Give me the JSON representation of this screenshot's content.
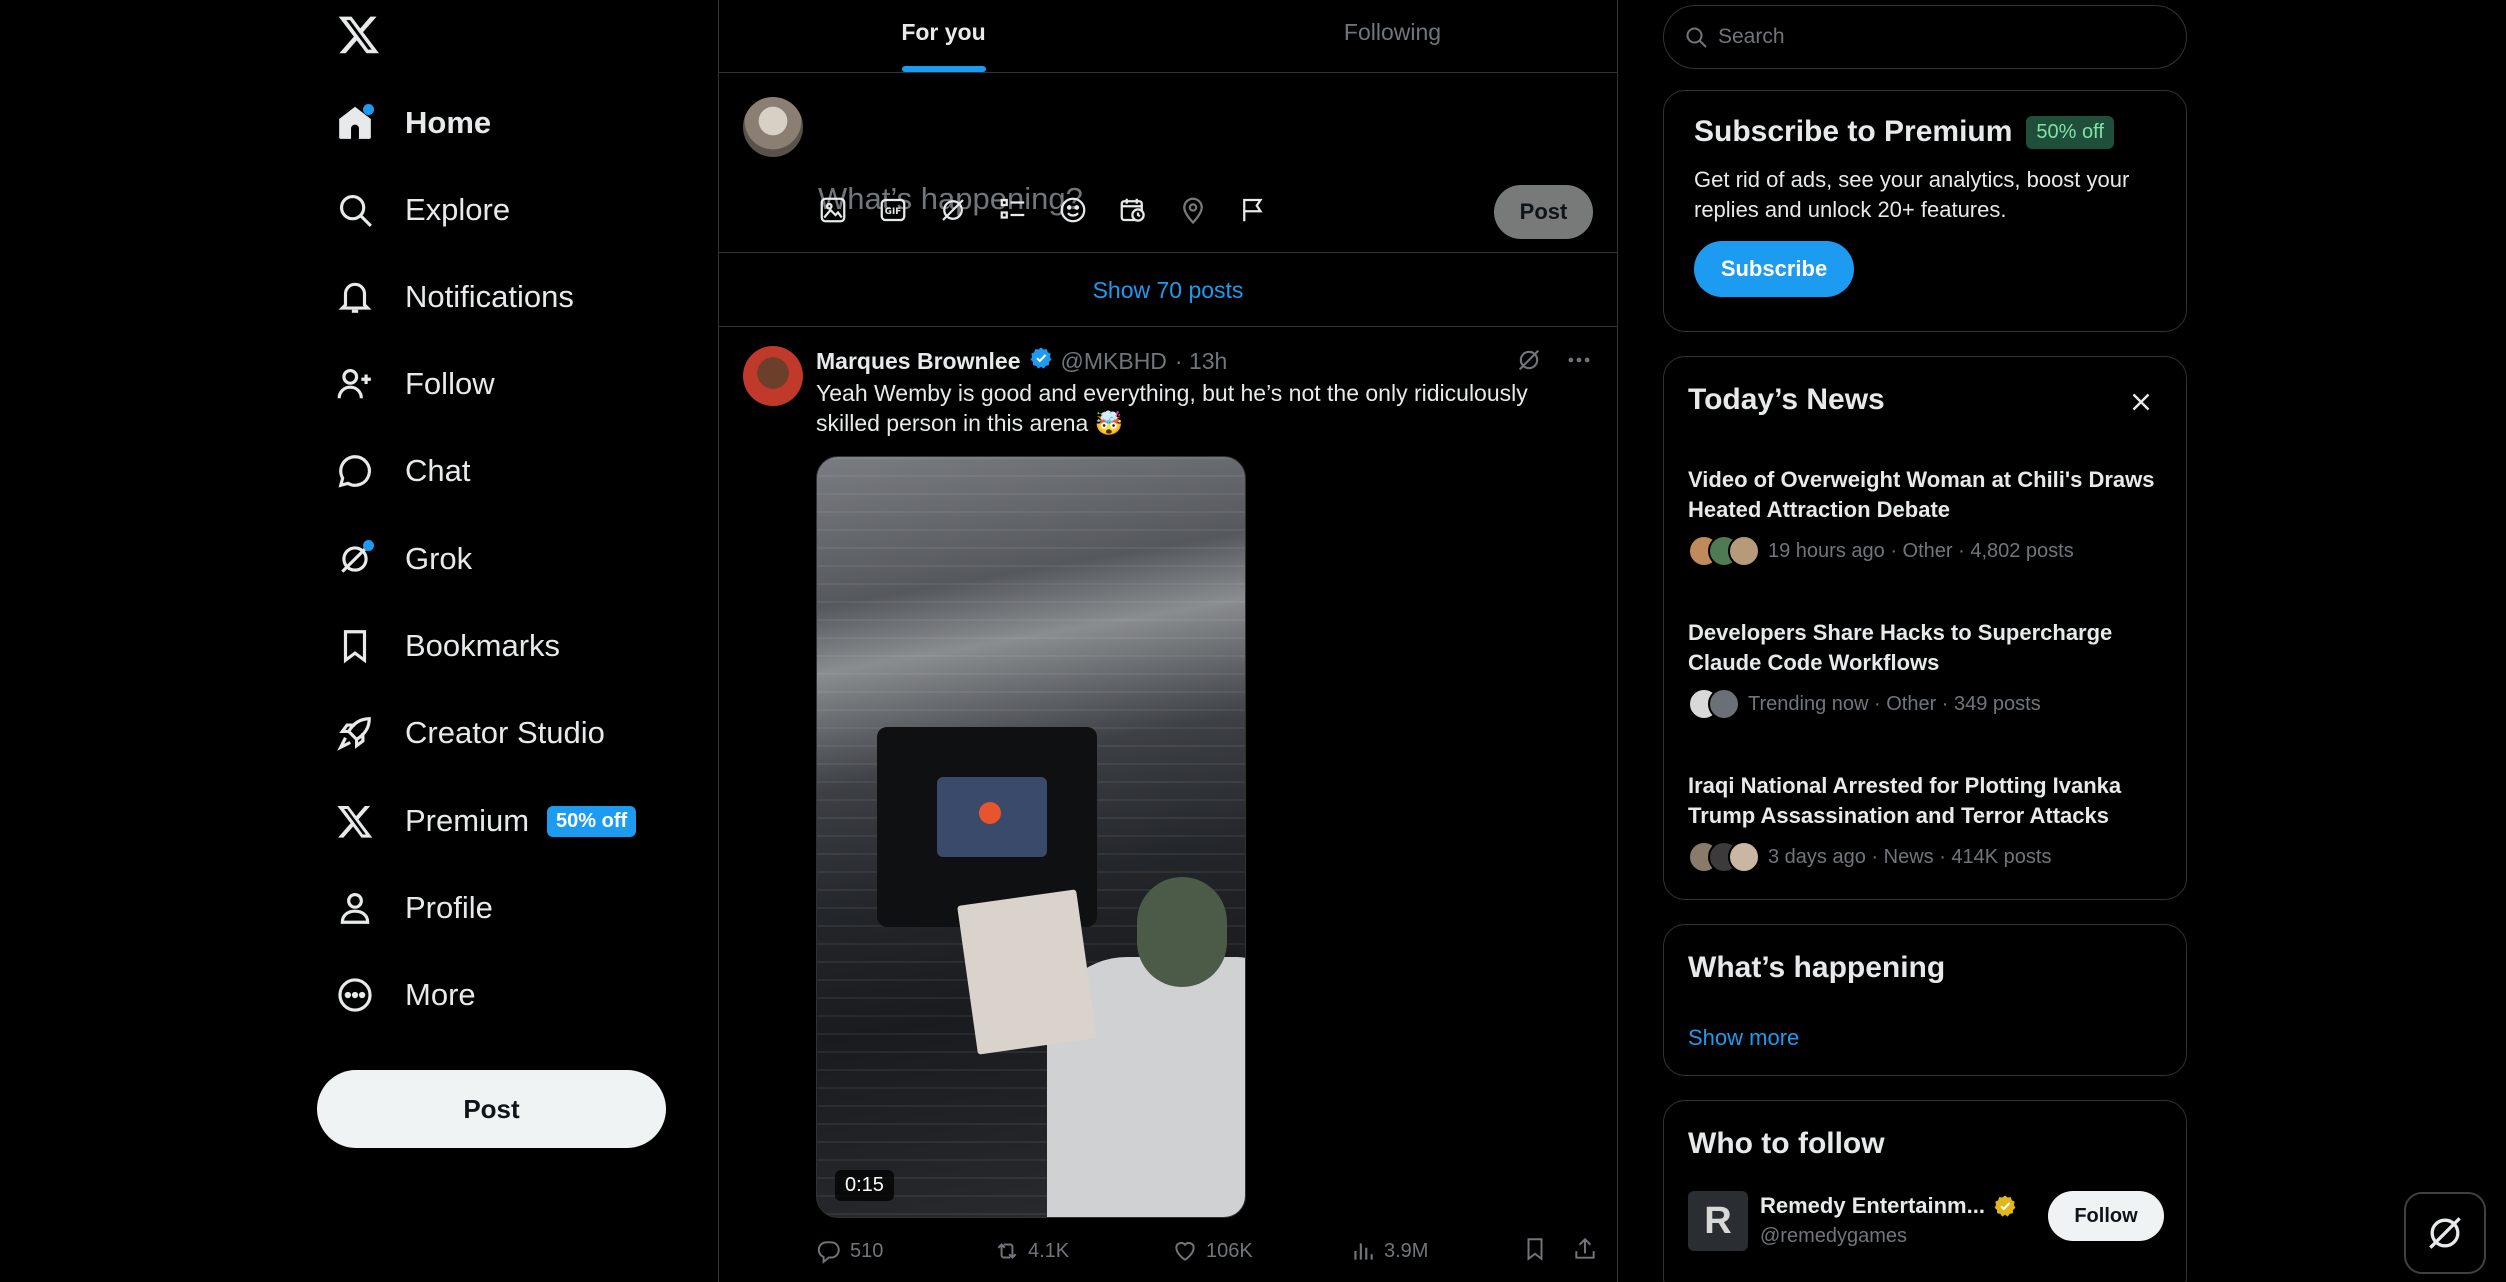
{
  "nav": {
    "items": [
      {
        "label": "Home",
        "icon": "home-icon",
        "active": true,
        "dot": true
      },
      {
        "label": "Explore",
        "icon": "search-icon"
      },
      {
        "label": "Notifications",
        "icon": "bell-icon"
      },
      {
        "label": "Follow",
        "icon": "follow-icon"
      },
      {
        "label": "Chat",
        "icon": "chat-icon"
      },
      {
        "label": "Grok",
        "icon": "grok-icon",
        "dot": true
      },
      {
        "label": "Bookmarks",
        "icon": "bookmark-icon"
      },
      {
        "label": "Creator Studio",
        "icon": "rocket-icon"
      },
      {
        "label": "Premium",
        "icon": "x-logo-icon",
        "badge": "50% off"
      },
      {
        "label": "Profile",
        "icon": "person-icon"
      },
      {
        "label": "More",
        "icon": "more-circle-icon"
      }
    ],
    "post_label": "Post"
  },
  "feed": {
    "tabs": [
      {
        "label": "For you",
        "active": true
      },
      {
        "label": "Following",
        "active": false
      }
    ],
    "composer": {
      "placeholder": "What’s happening?",
      "post_label": "Post"
    },
    "show_posts": "Show 70 posts",
    "tweet": {
      "name": "Marques Brownlee",
      "handle": "@MKBHD",
      "time": "· 13h",
      "text": "Yeah Wemby is good and everything, but he’s not the only ridiculously skilled person in this arena 🤯",
      "video_duration": "0:15",
      "replies": "510",
      "reposts": "4.1K",
      "likes": "106K",
      "views": "3.9M"
    }
  },
  "sidebar": {
    "search_placeholder": "Search",
    "premium": {
      "title": "Subscribe to Premium",
      "badge": "50% off",
      "description": "Get rid of ads, see your analytics, boost your replies and unlock 20+ features.",
      "button": "Subscribe"
    },
    "news": {
      "title": "Today’s News",
      "items": [
        {
          "title": "Video of Overweight Woman at Chili's Draws Heated Attraction Debate",
          "meta": "19 hours ago · Other · 4,802 posts"
        },
        {
          "title": "Developers Share Hacks to Supercharge Claude Code Workflows",
          "meta": "Trending now · Other · 349 posts"
        },
        {
          "title": "Iraqi National Arrested for Plotting Ivanka Trump Assassination and Terror Attacks",
          "meta": "3 days ago · News · 414K posts"
        }
      ]
    },
    "happening": {
      "title": "What’s happening",
      "show_more": "Show more"
    },
    "who_to_follow": {
      "title": "Who to follow",
      "name": "Remedy Entertainm...",
      "handle": "@remedygames",
      "avatar_letter": "R",
      "button": "Follow"
    }
  },
  "colors": {
    "accent": "#1d9bf0",
    "background": "#000000",
    "border": "#2f3336",
    "muted": "#71767b"
  }
}
